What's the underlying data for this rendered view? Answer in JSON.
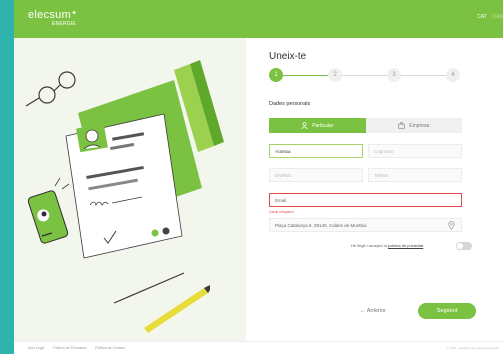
{
  "header": {
    "logo_text": "elecsum",
    "logo_sub": "ENERGIE",
    "lang_active": "CAT",
    "lang_other": "CAS"
  },
  "form": {
    "title": "Uneix-te",
    "steps": [
      "1",
      "2",
      "3",
      "4"
    ],
    "section_label": "Dades personals",
    "tabs": [
      {
        "label": "Particular",
        "icon": "person-icon",
        "active": true
      },
      {
        "label": "Empresa",
        "icon": "briefcase-icon",
        "active": false
      }
    ],
    "fields": {
      "first_name": {
        "value": "Arantxa",
        "placeholder": "Nom"
      },
      "surname": {
        "placeholder": "Cognoms"
      },
      "dni": {
        "placeholder": "DNI/NIE"
      },
      "phone": {
        "placeholder": "Telèfon"
      },
      "email": {
        "placeholder": "Email"
      },
      "email_error": "Camp obligatori",
      "address": {
        "value": "Plaça Catalunya 6, 08140, Caldes de Montbui"
      }
    },
    "consent_text": "He llegit i accepto la ",
    "consent_link": "política de privacitat",
    "prev_label": "← Anterior",
    "next_label": "Següent"
  },
  "footer": {
    "links": [
      "Avís Legal",
      "Política de Privadesa",
      "Política de Cookies"
    ],
    "copyright": "© 2021 · Elecsum Energia Cooperativa"
  },
  "colors": {
    "brand_green": "#7cc242",
    "teal_background": "#2fb3ad",
    "error_red": "#e34d4d"
  }
}
